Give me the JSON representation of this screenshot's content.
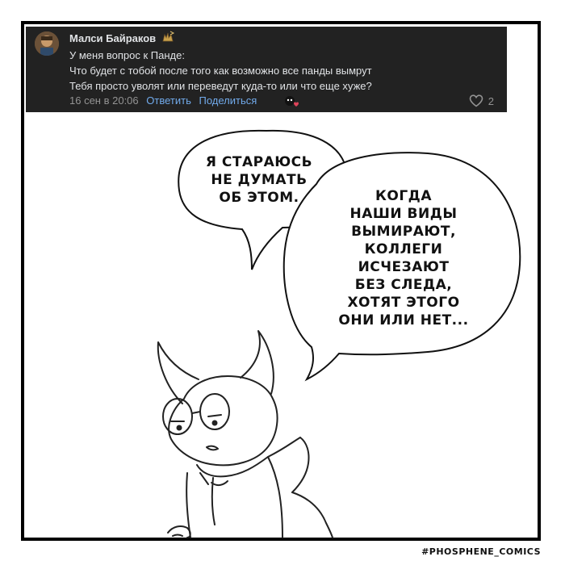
{
  "comment": {
    "author": "Малси Байраков",
    "lines": [
      "У меня вопрос к Панде:",
      "Что будет с тобой после того как возможно все панды вымрут",
      "Тебя просто уволят или переведут куда-то или что еще хуже?"
    ],
    "date": "16 сен в 20:06",
    "reply_label": "Ответить",
    "share_label": "Поделиться",
    "likes": "2",
    "colors": {
      "background": "#222222",
      "text": "#e1e3e6",
      "link": "#71aaeb",
      "meta": "#939393"
    }
  },
  "speech1": [
    "Я СТАРАЮСЬ",
    "НЕ ДУМАТЬ",
    "ОБ ЭТОМ."
  ],
  "speech2": [
    "КОГДА",
    "НАШИ ВИДЫ",
    "ВЫМИРАЮТ,",
    "КОЛЛЕГИ",
    "ИСЧЕЗАЮТ",
    "БЕЗ СЛЕДА,",
    "ХОТЯТ ЭТОГО",
    "ОНИ ИЛИ НЕТ..."
  ],
  "hashtag": "#PHOSPHENE_COMICS"
}
